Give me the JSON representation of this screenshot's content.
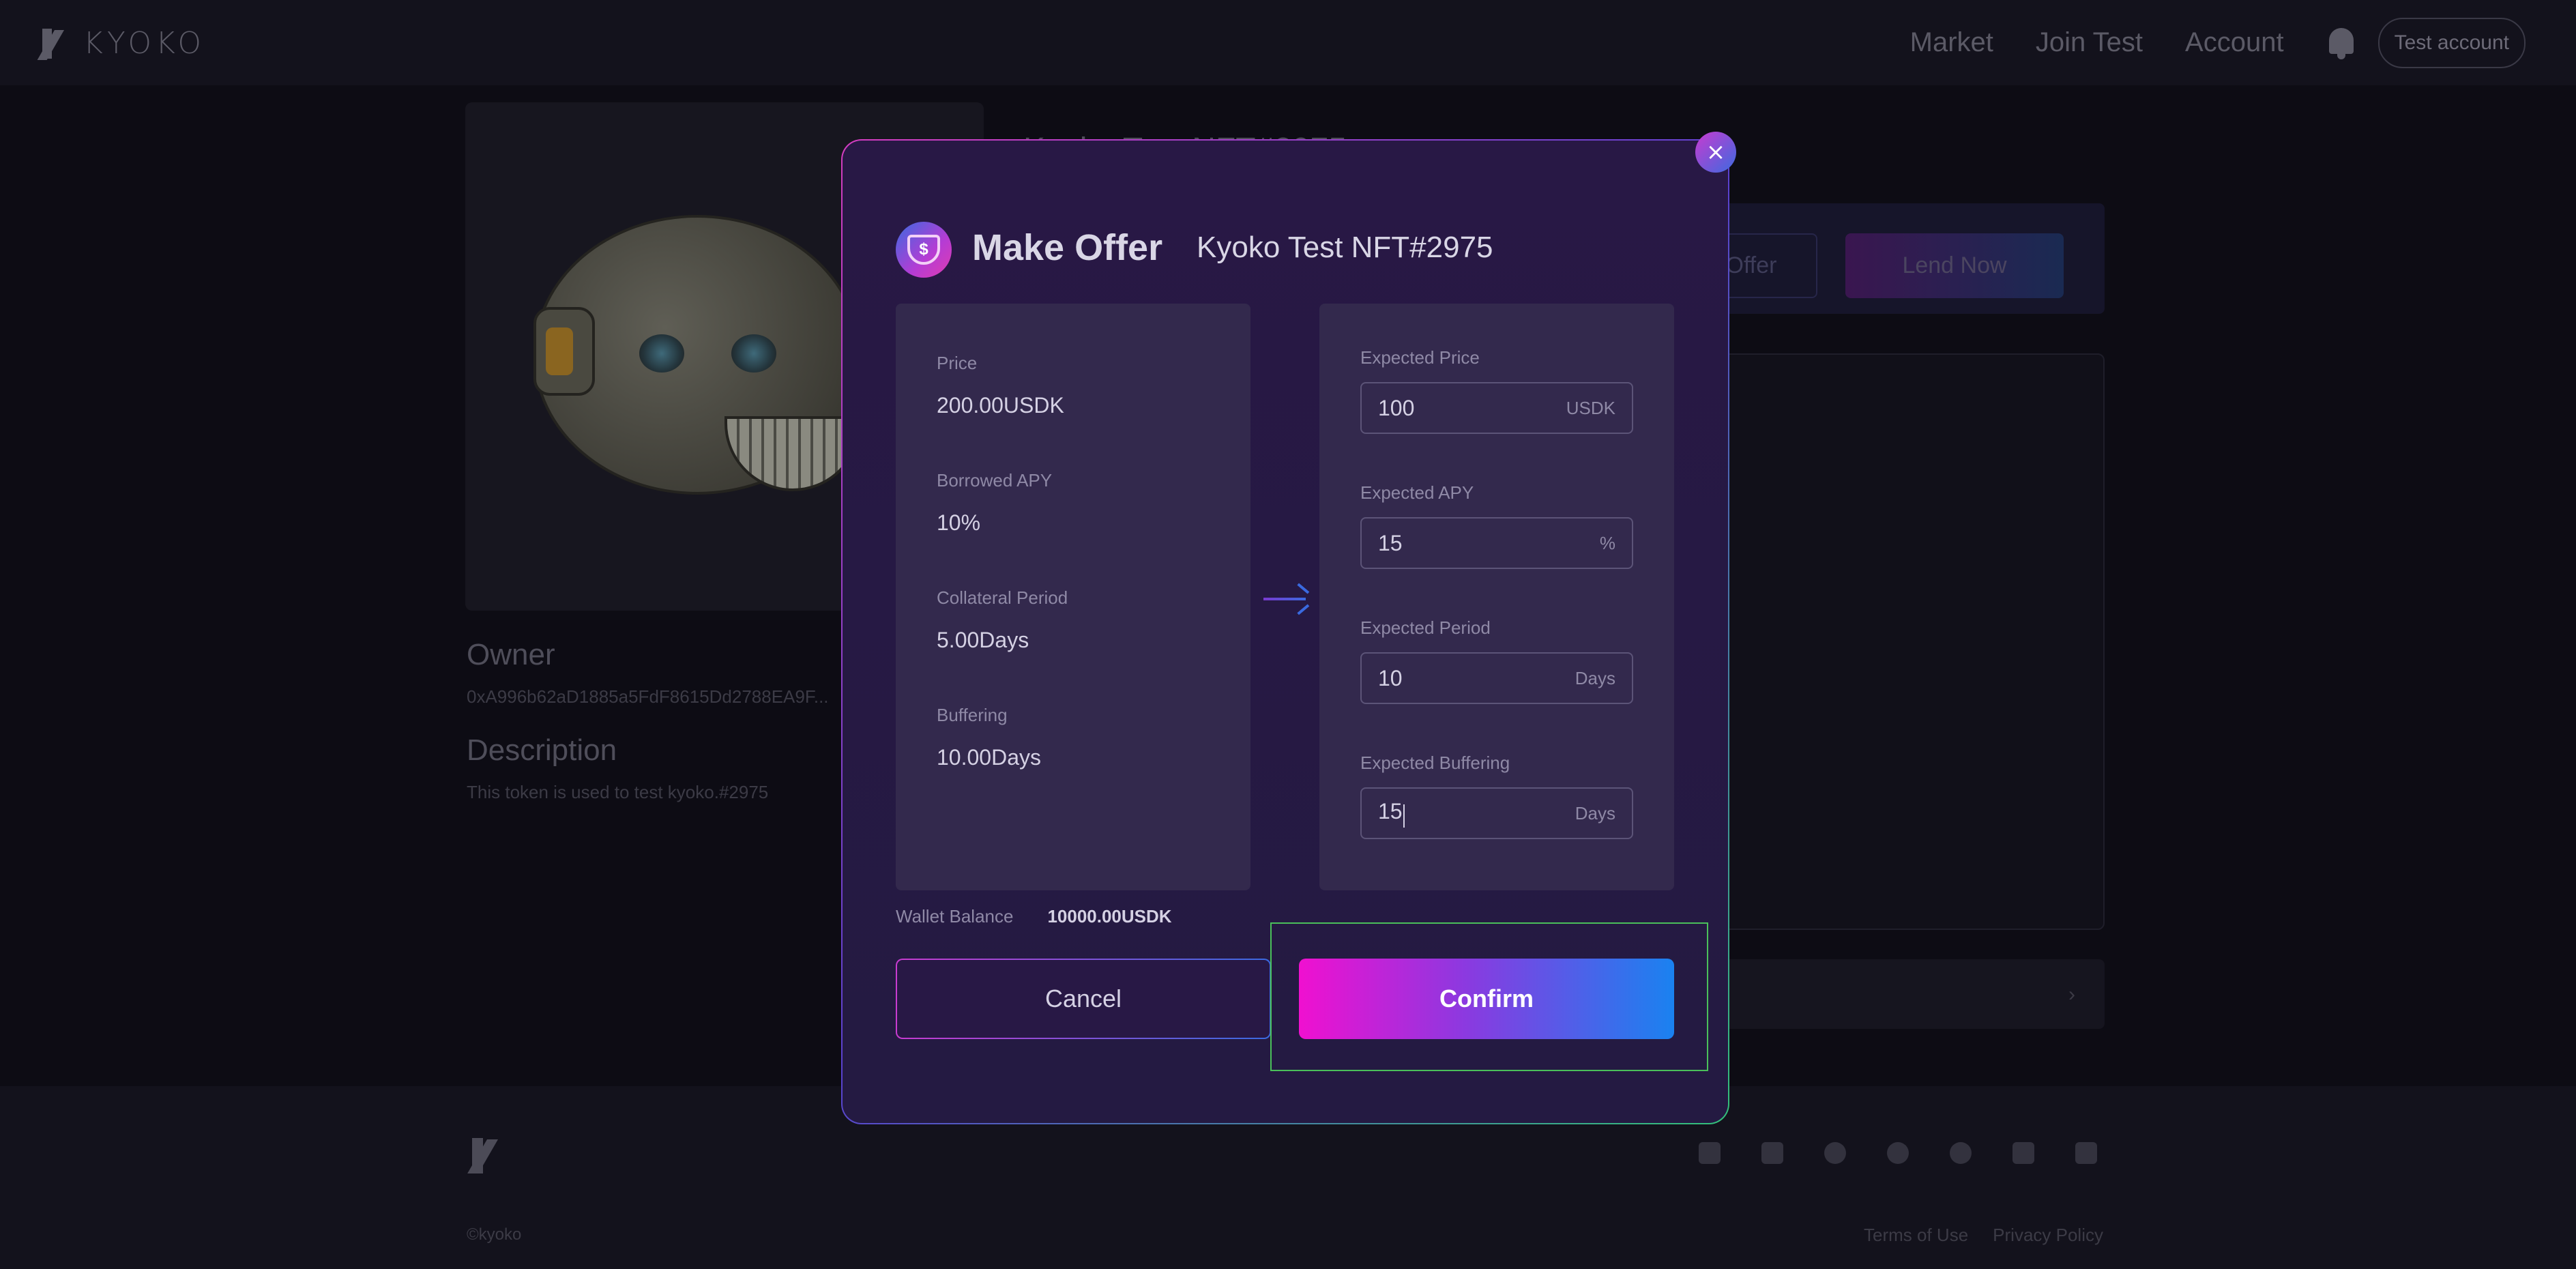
{
  "header": {
    "logo_text": "KYOKO",
    "nav": [
      "Market",
      "Join Test",
      "Account"
    ],
    "account_button": "Test account"
  },
  "background": {
    "nft_title": "Kyoko Test NFT#2975",
    "buttons": {
      "offer": "Offer",
      "lend_now": "Lend Now"
    },
    "owner_label": "Owner",
    "owner_address": "0xA996b62aD1885a5FdF8615Dd2788EA9F...",
    "description_label": "Description",
    "description_text": "This token is used to test kyoko.#2975"
  },
  "modal": {
    "title": "Make Offer",
    "nft_name": "Kyoko Test NFT#2975",
    "current": [
      {
        "label": "Price",
        "value": "200.00USDK"
      },
      {
        "label": "Borrowed APY",
        "value": "10%"
      },
      {
        "label": "Collateral Period",
        "value": "5.00Days"
      },
      {
        "label": "Buffering",
        "value": "10.00Days"
      }
    ],
    "fields": [
      {
        "label": "Expected Price",
        "value": "100",
        "unit": "USDK"
      },
      {
        "label": "Expected APY",
        "value": "15",
        "unit": "%"
      },
      {
        "label": "Expected Period",
        "value": "10",
        "unit": "Days"
      },
      {
        "label": "Expected Buffering",
        "value": "15",
        "unit": "Days"
      }
    ],
    "wallet_label": "Wallet Balance",
    "wallet_amount": "10000.00USDK",
    "cancel_label": "Cancel",
    "confirm_label": "Confirm",
    "close_symbol": "×"
  },
  "footer": {
    "copyright": "©kyoko",
    "links": [
      "Terms of Use",
      "Privacy Policy"
    ],
    "social_icons": [
      "twitter-icon",
      "docs-icon",
      "medium-icon",
      "telegram-icon",
      "github-icon",
      "discord-icon",
      "gitbook-icon"
    ]
  },
  "colors": {
    "accent_pink": "#f010d0",
    "accent_blue": "#1a82f0",
    "modal_bg": "#281845",
    "highlight_frame": "#4ac05a"
  }
}
